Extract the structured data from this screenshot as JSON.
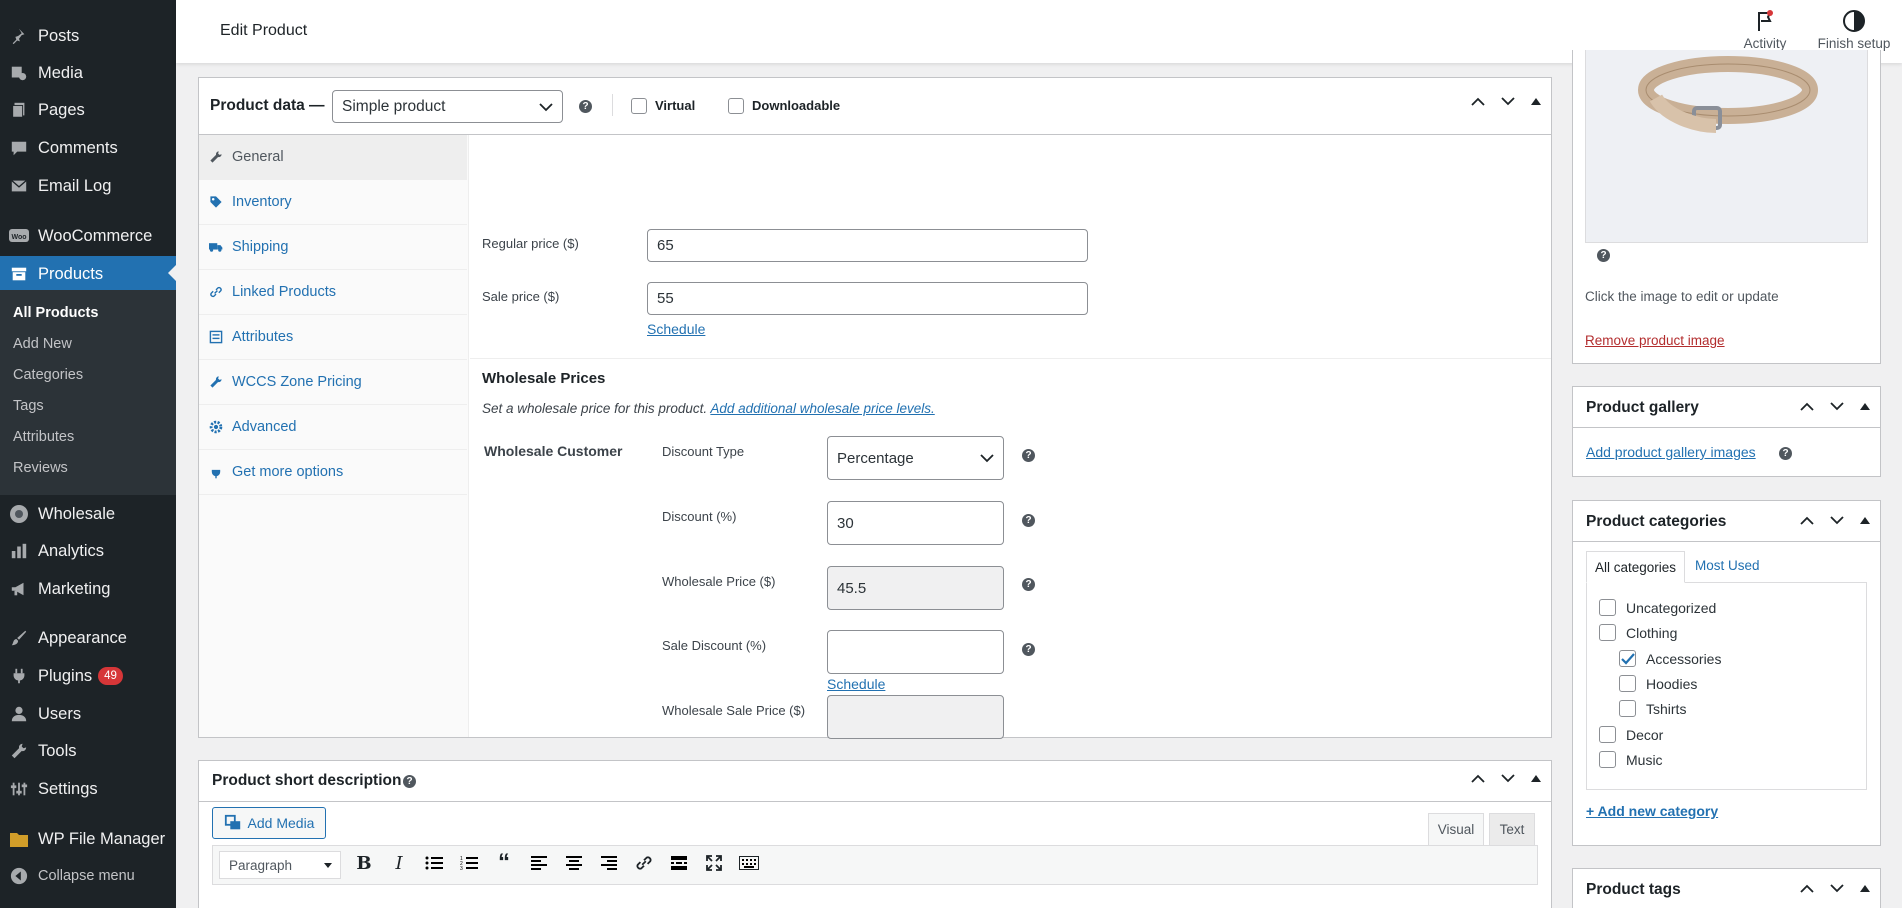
{
  "sidebar": {
    "items": [
      {
        "label": "Posts",
        "icon": "pushpin-icon"
      },
      {
        "label": "Media",
        "icon": "media-icon"
      },
      {
        "label": "Pages",
        "icon": "pages-icon"
      },
      {
        "label": "Comments",
        "icon": "comment-icon"
      },
      {
        "label": "Email Log",
        "icon": "email-icon"
      },
      {
        "label": "WooCommerce",
        "icon": "woo-icon"
      },
      {
        "label": "Products",
        "icon": "archive-icon"
      },
      {
        "label": "Wholesale",
        "icon": "wholesale-icon"
      },
      {
        "label": "Analytics",
        "icon": "chart-bar-icon"
      },
      {
        "label": "Marketing",
        "icon": "megaphone-icon"
      },
      {
        "label": "Appearance",
        "icon": "brush-icon"
      },
      {
        "label": "Plugins",
        "icon": "plug-icon",
        "badge": "49"
      },
      {
        "label": "Users",
        "icon": "users-icon"
      },
      {
        "label": "Tools",
        "icon": "wrench-icon"
      },
      {
        "label": "Settings",
        "icon": "settings-icon"
      },
      {
        "label": "WP File Manager",
        "icon": "folder-icon"
      },
      {
        "label": "Collapse menu",
        "icon": "collapse-icon"
      }
    ],
    "submenu": [
      "All Products",
      "Add New",
      "Categories",
      "Tags",
      "Attributes",
      "Reviews"
    ]
  },
  "header": {
    "title": "Edit Product",
    "activity": "Activity",
    "finish_setup": "Finish setup"
  },
  "product_data": {
    "title": "Product data —",
    "type": "Simple product",
    "virtual": "Virtual",
    "downloadable": "Downloadable",
    "tabs": [
      "General",
      "Inventory",
      "Shipping",
      "Linked Products",
      "Attributes",
      "WCCS Zone Pricing",
      "Advanced",
      "Get more options"
    ],
    "regular_price_label": "Regular price ($)",
    "regular_price": "65",
    "sale_price_label": "Sale price ($)",
    "sale_price": "55",
    "schedule": "Schedule",
    "wholesale": {
      "heading": "Wholesale Prices",
      "desc": "Set a wholesale price for this product.",
      "desc_link": "Add additional wholesale price levels.",
      "role": "Wholesale Customer",
      "discount_type_label": "Discount Type",
      "discount_type": "Percentage",
      "discount_label": "Discount (%)",
      "discount": "30",
      "wholesale_price_label": "Wholesale Price ($)",
      "wholesale_price": "45.5",
      "sale_discount_label": "Sale Discount (%)",
      "sale_discount": "",
      "wholesale_sale_price_label": "Wholesale Sale Price ($)",
      "wholesale_sale_price": "",
      "schedule": "Schedule"
    }
  },
  "short_description": {
    "title": "Product short description",
    "add_media": "Add Media",
    "visual": "Visual",
    "text": "Text",
    "format": "Paragraph"
  },
  "product_image": {
    "hint": "Click the image to edit or update",
    "remove": "Remove product image"
  },
  "gallery": {
    "title": "Product gallery",
    "add": "Add product gallery images"
  },
  "categories": {
    "title": "Product categories",
    "tab_all": "All categories",
    "tab_most": "Most Used",
    "items": [
      {
        "label": "Uncategorized",
        "checked": false
      },
      {
        "label": "Clothing",
        "checked": false
      },
      {
        "label": "Accessories",
        "checked": true
      },
      {
        "label": "Hoodies",
        "checked": false
      },
      {
        "label": "Tshirts",
        "checked": false
      },
      {
        "label": "Decor",
        "checked": false
      },
      {
        "label": "Music",
        "checked": false
      }
    ],
    "add_new": "+ Add new category"
  },
  "tags": {
    "title": "Product tags"
  },
  "colors": {
    "sidebar": "#1d2327",
    "accent": "#2271b1",
    "badge": "#d63638",
    "remove_link": "#b32d2e"
  }
}
